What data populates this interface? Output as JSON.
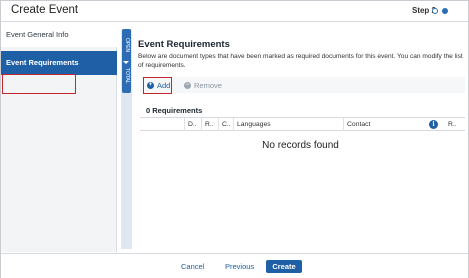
{
  "window": {
    "title": "Create Event",
    "step_label": "Step 2"
  },
  "colors": {
    "accent": "#1f5fa6",
    "highlight_outline": "#c0282d"
  },
  "sidebar": {
    "items": [
      {
        "label": "Event General Info"
      },
      {
        "label": "Event Requirements"
      }
    ]
  },
  "strip": {
    "open_label": "OPEN",
    "total_label": "TOTAL"
  },
  "section": {
    "title": "Event Requirements",
    "description": "Below are document types that have been marked as required documents for this event. You can modify the list of requirements."
  },
  "toolbar": {
    "add_label": "Add",
    "remove_label": "Remove"
  },
  "grid": {
    "count_label": "0 Requirements",
    "columns": [
      "D..",
      "R..",
      "C..",
      "Languages",
      "Contact",
      "R.."
    ],
    "empty_message": "No records found"
  },
  "footer": {
    "cancel_label": "Cancel",
    "previous_label": "Previous",
    "create_label": "Create"
  }
}
